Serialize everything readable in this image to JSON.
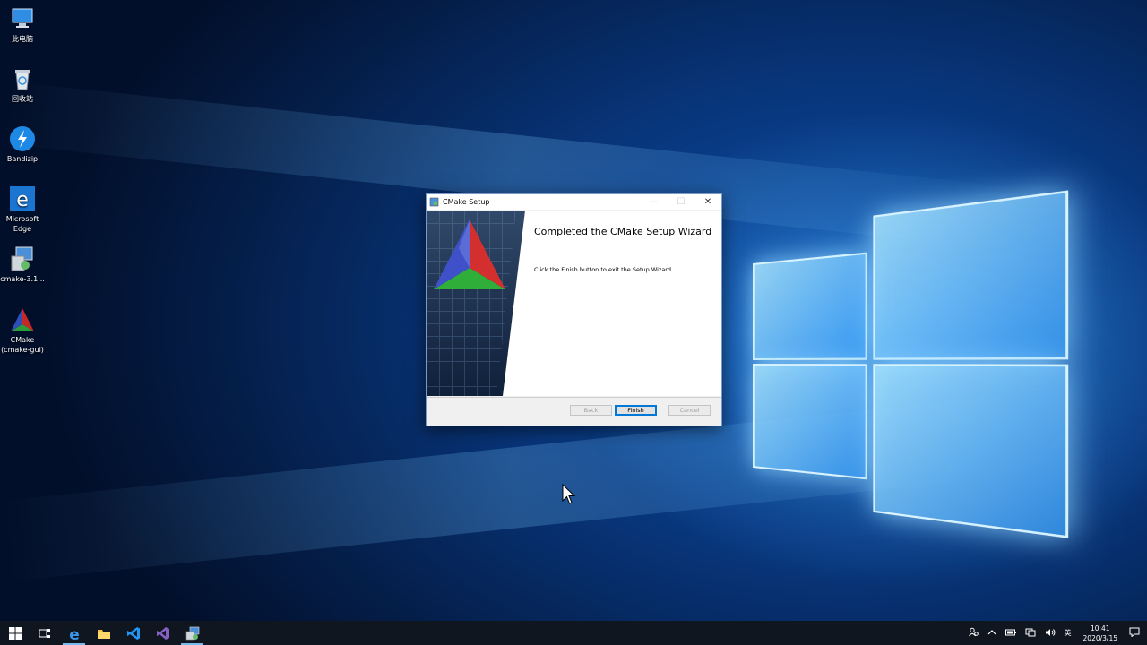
{
  "desktop": {
    "icons": [
      {
        "label": "此电脑",
        "icon": "computer-icon"
      },
      {
        "label": "回收站",
        "icon": "recycle-bin-icon"
      },
      {
        "label": "Bandizip",
        "icon": "bandizip-icon"
      },
      {
        "label": "Microsoft Edge",
        "icon": "edge-icon"
      },
      {
        "label": "cmake-3.1...",
        "icon": "installer-icon"
      },
      {
        "label": "CMake (cmake-gui)",
        "icon": "cmake-icon"
      }
    ]
  },
  "dialog": {
    "title": "CMake Setup",
    "heading": "Completed the CMake Setup Wizard",
    "message": "Click the Finish button to exit the Setup Wizard.",
    "buttons": {
      "back": "Back",
      "finish": "Finish",
      "cancel": "Cancel"
    },
    "controls": {
      "minimize": "—",
      "maximize": "☐",
      "close": "✕"
    }
  },
  "taskbar": {
    "items": [
      "start-icon",
      "task-view-icon",
      "edge-icon",
      "file-explorer-icon",
      "vscode-icon",
      "visual-studio-icon",
      "installer-icon"
    ],
    "tray": {
      "input_method": "英",
      "time": "10:41",
      "date": "2020/3/15"
    }
  },
  "colors": {
    "accent": "#0078d7",
    "taskbar": "#0f1620"
  }
}
